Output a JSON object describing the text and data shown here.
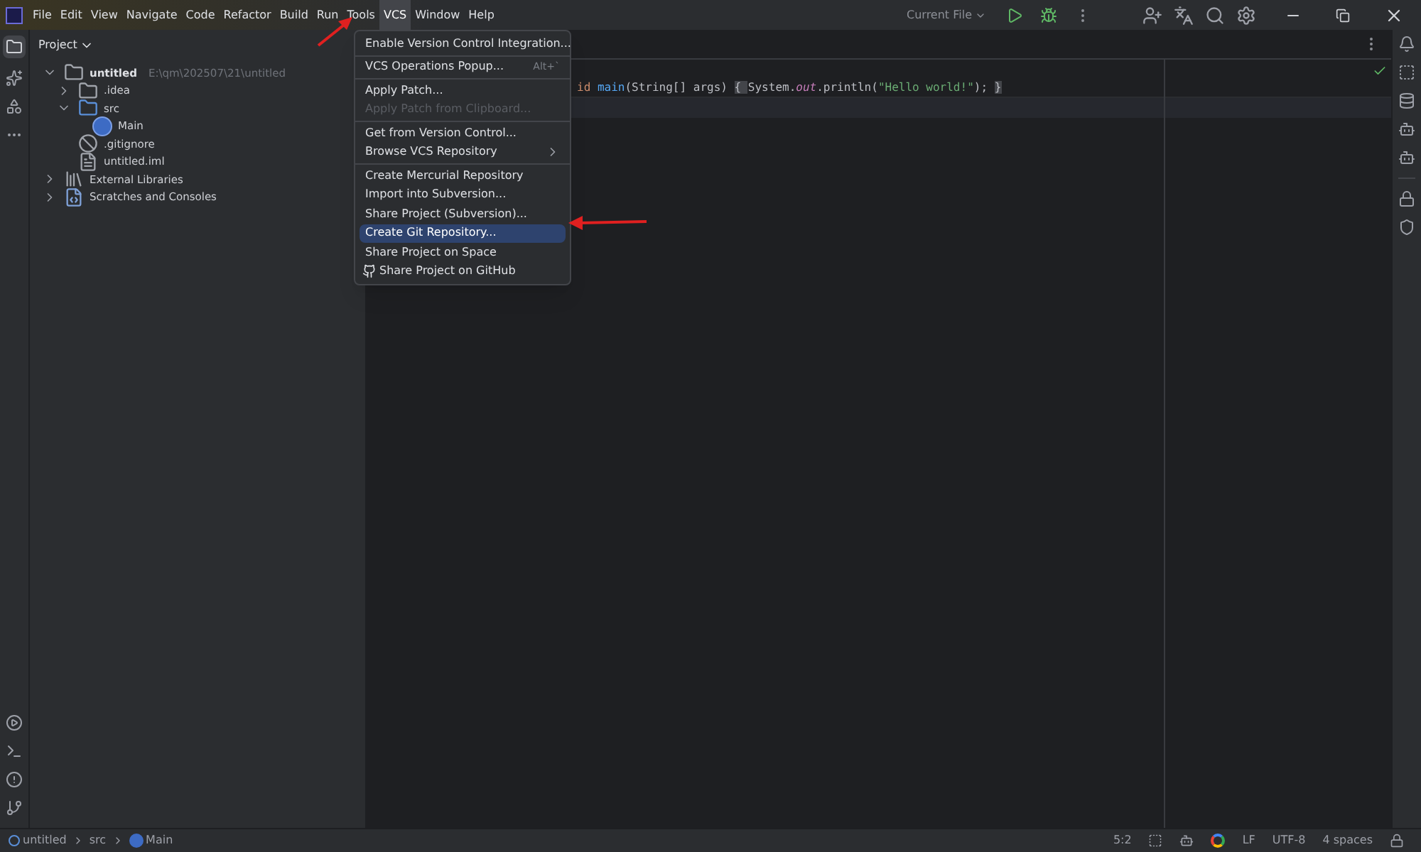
{
  "menu_bar": [
    {
      "label": "File",
      "selected": false
    },
    {
      "label": "Edit",
      "selected": false
    },
    {
      "label": "View",
      "selected": false
    },
    {
      "label": "Navigate",
      "selected": false
    },
    {
      "label": "Code",
      "selected": false
    },
    {
      "label": "Refactor",
      "selected": false
    },
    {
      "label": "Build",
      "selected": false
    },
    {
      "label": "Run",
      "selected": false
    },
    {
      "label": "Tools",
      "selected": false
    },
    {
      "label": "VCS",
      "selected": true
    },
    {
      "label": "Window",
      "selected": false
    },
    {
      "label": "Help",
      "selected": false
    }
  ],
  "run_config": "Current File",
  "project_panel": {
    "title": "Project",
    "tree": [
      {
        "label": "untitled",
        "path": "E:\\qm\\202507\\21\\untitled",
        "kind": "module",
        "expanded": true,
        "children": [
          {
            "label": ".idea",
            "kind": "folder",
            "expanded": false
          },
          {
            "label": "src",
            "kind": "source",
            "expanded": true,
            "children": [
              {
                "label": "Main",
                "kind": "class"
              }
            ]
          },
          {
            "label": ".gitignore",
            "kind": "ignore"
          },
          {
            "label": "untitled.iml",
            "kind": "file"
          }
        ]
      },
      {
        "label": "External Libraries",
        "kind": "library",
        "expanded": false
      },
      {
        "label": "Scratches and Consoles",
        "kind": "scratch",
        "expanded": false
      }
    ]
  },
  "editor": {
    "code": [
      {
        "kind": "keyword",
        "text": "id"
      },
      {
        "kind": "method",
        "text": "main"
      },
      {
        "kind": "plain",
        "text": "(String[] args) "
      },
      {
        "kind": "brace",
        "text": "{ "
      },
      {
        "kind": "plain",
        "text": "System."
      },
      {
        "kind": "field",
        "text": "out"
      },
      {
        "kind": "plain",
        "text": ".println("
      },
      {
        "kind": "string",
        "text": "\"Hello world!\""
      },
      {
        "kind": "plain",
        "text": "); "
      },
      {
        "kind": "brace",
        "text": "}"
      }
    ]
  },
  "vcs_menu": {
    "items": [
      {
        "kind": "item",
        "label": "Enable Version Control Integration...",
        "disabled": false,
        "selected": false
      },
      {
        "kind": "separator"
      },
      {
        "kind": "item",
        "label": "VCS Operations Popup...",
        "shortcut": "Alt+`",
        "disabled": false,
        "selected": false
      },
      {
        "kind": "separator"
      },
      {
        "kind": "item",
        "label": "Apply Patch...",
        "disabled": false,
        "selected": false
      },
      {
        "kind": "item",
        "label": "Apply Patch from Clipboard...",
        "disabled": true,
        "selected": false
      },
      {
        "kind": "separator"
      },
      {
        "kind": "item",
        "label": "Get from Version Control...",
        "disabled": false,
        "selected": false
      },
      {
        "kind": "submenu",
        "label": "Browse VCS Repository",
        "disabled": false,
        "selected": false
      },
      {
        "kind": "separator"
      },
      {
        "kind": "item",
        "label": "Create Mercurial Repository",
        "disabled": false,
        "selected": false
      },
      {
        "kind": "item",
        "label": "Import into Subversion...",
        "disabled": false,
        "selected": false
      },
      {
        "kind": "item",
        "label": "Share Project (Subversion)...",
        "disabled": false,
        "selected": false
      },
      {
        "kind": "item",
        "label": "Create Git Repository...",
        "disabled": false,
        "selected": true
      },
      {
        "kind": "item",
        "label": "Share Project on Space",
        "disabled": false,
        "selected": false
      },
      {
        "kind": "github",
        "label": "Share Project on GitHub",
        "disabled": false,
        "selected": false
      }
    ]
  },
  "status_bar": {
    "breadcrumbs": [
      {
        "label": "untitled",
        "kind": "module"
      },
      {
        "label": "src",
        "kind": "folder"
      },
      {
        "label": "Main",
        "kind": "class"
      }
    ],
    "position": "5:2",
    "line_separator": "LF",
    "encoding": "UTF-8",
    "indent": "4 spaces"
  }
}
